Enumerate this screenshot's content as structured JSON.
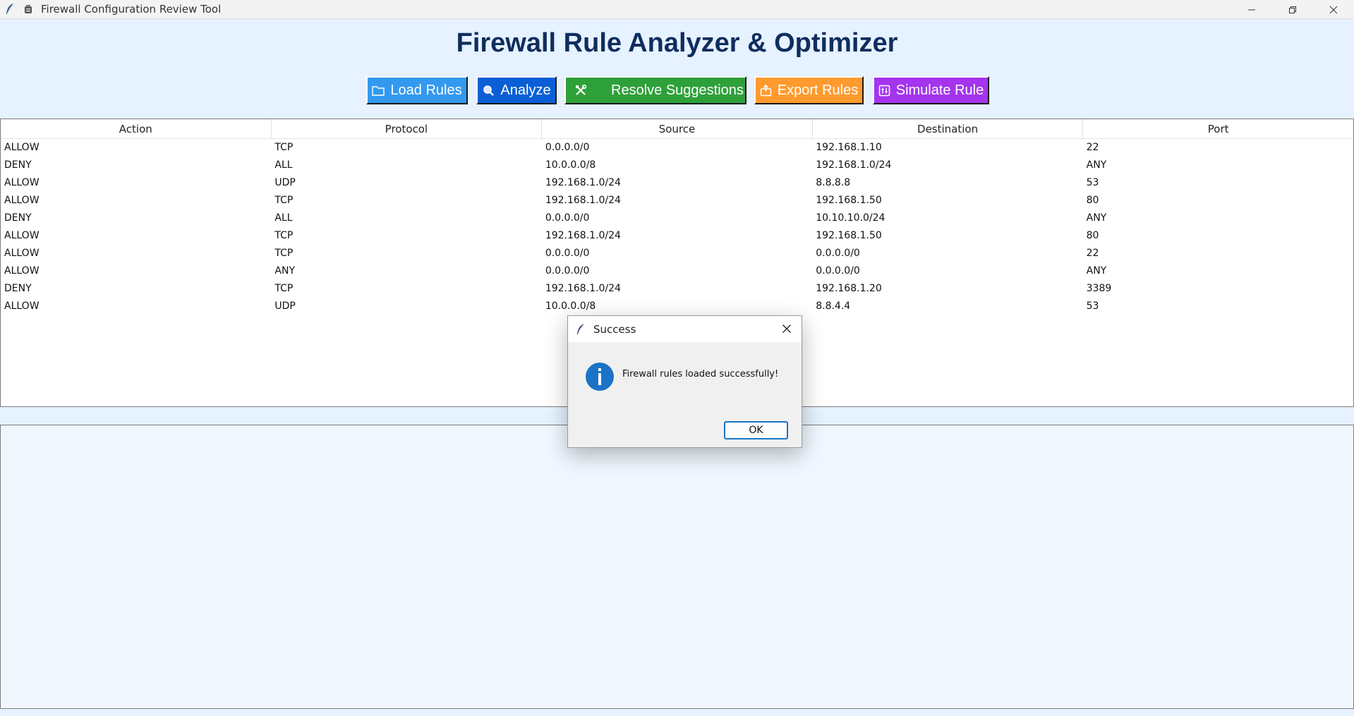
{
  "window": {
    "title": "Firewall Configuration Review Tool",
    "controls": [
      "minimize-icon",
      "restore-icon",
      "close-icon"
    ]
  },
  "heading": "Firewall Rule Analyzer & Optimizer",
  "toolbar": {
    "load": {
      "label": "Load Rules",
      "icon": "folder-icon",
      "color": "#3399ee"
    },
    "analyze": {
      "label": "Analyze",
      "icon": "magnifier-icon",
      "color": "#0a5fd6"
    },
    "resolve": {
      "label": "Resolve Suggestions",
      "icon": "tools-icon",
      "color": "#2ea03a"
    },
    "export": {
      "label": "Export Rules",
      "icon": "export-icon",
      "color": "#ff9a2e"
    },
    "simulate": {
      "label": "Simulate Rule",
      "icon": "simulate-icon",
      "color": "#a434ee"
    }
  },
  "table": {
    "columns": [
      "Action",
      "Protocol",
      "Source",
      "Destination",
      "Port"
    ],
    "rows": [
      [
        "ALLOW",
        "TCP",
        "0.0.0.0/0",
        "192.168.1.10",
        "22"
      ],
      [
        "DENY",
        "ALL",
        "10.0.0.0/8",
        "192.168.1.0/24",
        "ANY"
      ],
      [
        "ALLOW",
        "UDP",
        "192.168.1.0/24",
        "8.8.8.8",
        "53"
      ],
      [
        "ALLOW",
        "TCP",
        "192.168.1.0/24",
        "192.168.1.50",
        "80"
      ],
      [
        "DENY",
        "ALL",
        "0.0.0.0/0",
        "10.10.10.0/24",
        "ANY"
      ],
      [
        "ALLOW",
        "TCP",
        "192.168.1.0/24",
        "192.168.1.50",
        "80"
      ],
      [
        "ALLOW",
        "TCP",
        "0.0.0.0/0",
        "0.0.0.0/0",
        "22"
      ],
      [
        "ALLOW",
        "ANY",
        "0.0.0.0/0",
        "0.0.0.0/0",
        "ANY"
      ],
      [
        "DENY",
        "TCP",
        "192.168.1.0/24",
        "192.168.1.20",
        "3389"
      ],
      [
        "ALLOW",
        "UDP",
        "10.0.0.0/8",
        "8.8.4.4",
        "53"
      ]
    ]
  },
  "dialog": {
    "title": "Success",
    "message": "Firewall rules loaded successfully!",
    "ok_label": "OK",
    "icon": "info-icon"
  }
}
